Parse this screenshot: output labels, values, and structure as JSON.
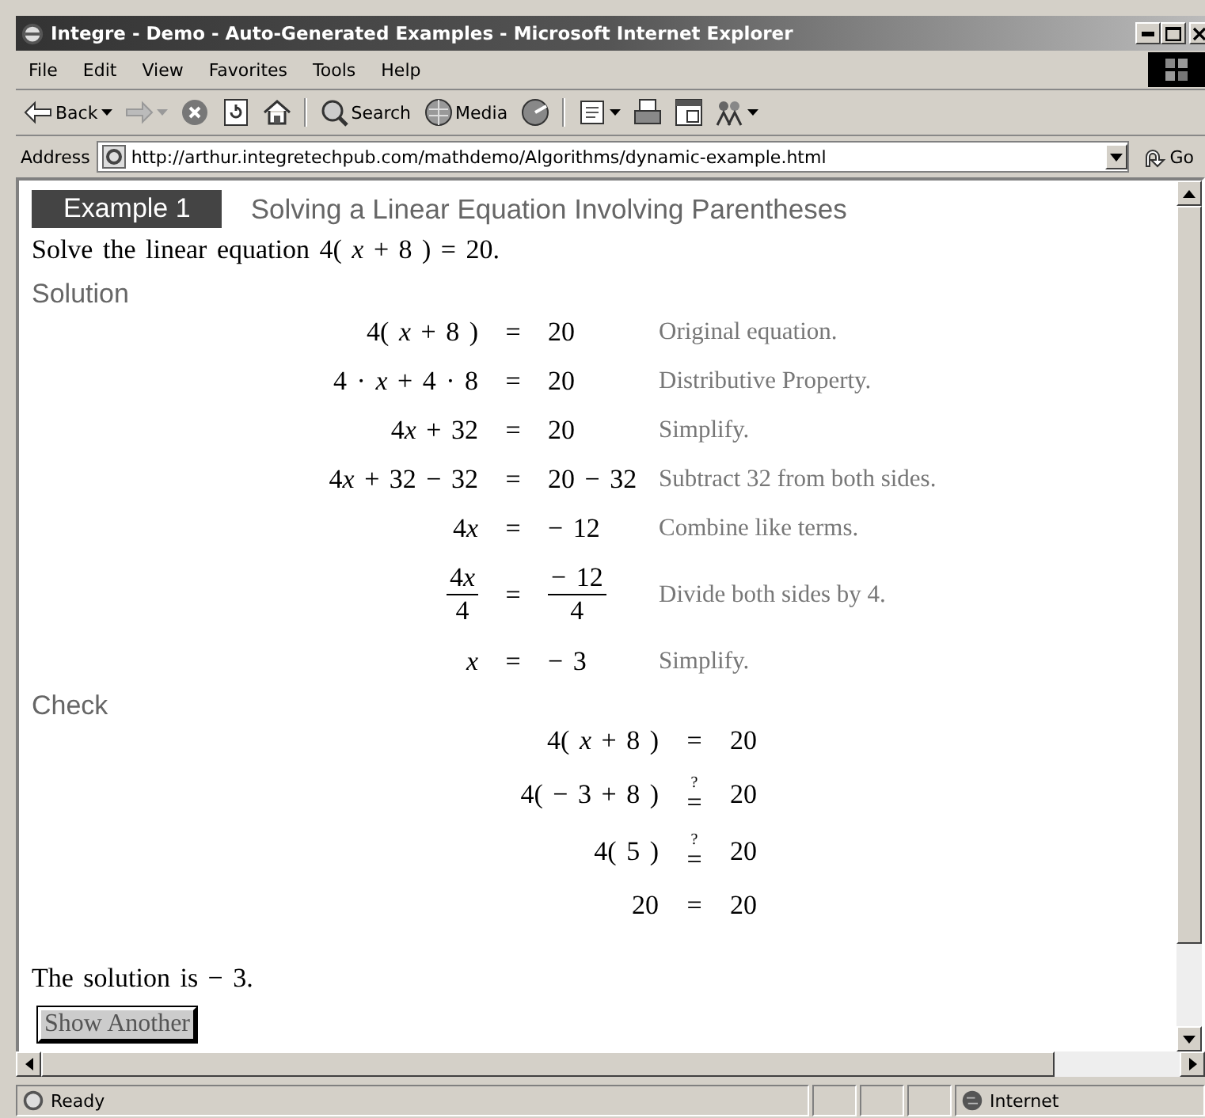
{
  "window": {
    "title": "Integre - Demo - Auto-Generated Examples - Microsoft Internet Explorer"
  },
  "menu": [
    "File",
    "Edit",
    "View",
    "Favorites",
    "Tools",
    "Help"
  ],
  "toolbar": [
    {
      "kind": "back",
      "label": "Back"
    },
    {
      "kind": "forward"
    },
    {
      "kind": "stop"
    },
    {
      "kind": "refresh"
    },
    {
      "kind": "home"
    },
    {
      "kind": "separator"
    },
    {
      "kind": "search",
      "label": "Search"
    },
    {
      "kind": "media",
      "label": "Media"
    },
    {
      "kind": "history"
    },
    {
      "kind": "separator"
    },
    {
      "kind": "mail"
    },
    {
      "kind": "print"
    },
    {
      "kind": "edit"
    },
    {
      "kind": "messenger"
    }
  ],
  "address": {
    "label": "Address",
    "value": "http://arthur.integretechpub.com/mathdemo/Algorithms/dynamic-example.html",
    "go": "Go"
  },
  "page": {
    "badge": "Example 1",
    "title": "Solving a Linear Equation Involving Parentheses",
    "problem": "Solve the linear equation 4( *x* + 8 ) = 20.",
    "solution_heading": "Solution",
    "solution": [
      {
        "kind": "plain",
        "lhs": "4( x + 8 )",
        "rel": "=",
        "rhs": "20",
        "note": "Original equation."
      },
      {
        "kind": "plain",
        "lhs": "4 · x + 4 · 8",
        "rel": "=",
        "rhs": "20",
        "note": "Distributive Property."
      },
      {
        "kind": "plain",
        "lhs": "4x + 32",
        "rel": "=",
        "rhs": "20",
        "note": "Simplify."
      },
      {
        "kind": "plain",
        "lhs": "4x + 32 − 32",
        "rel": "=",
        "rhs": "20 − 32",
        "note": "Subtract 32 from both sides."
      },
      {
        "kind": "plain",
        "lhs": "4x",
        "rel": "=",
        "rhs": "− 12",
        "note": "Combine like terms."
      },
      {
        "kind": "fraction",
        "lhs": {
          "num": "4x",
          "den": "4"
        },
        "rel": "=",
        "rhs": {
          "num": "− 12",
          "den": "4"
        },
        "note": "Divide both sides by 4."
      },
      {
        "kind": "plain",
        "lhs": "x",
        "rel": "=",
        "rhs": "− 3",
        "note": "Simplify."
      }
    ],
    "check_heading": "Check",
    "check": [
      {
        "lhs": "4( x + 8 )",
        "rel": "=",
        "rhs": "20"
      },
      {
        "lhs": "4( − 3 + 8 )",
        "query": "?",
        "rel": "=",
        "rhs": "20"
      },
      {
        "lhs": "4( 5 )",
        "query": "?",
        "rel": "=",
        "rhs": "20"
      },
      {
        "lhs": "20",
        "rel": "=",
        "rhs": "20"
      }
    ],
    "conclusion": "The solution is − 3.",
    "button": "Show Another"
  },
  "status": {
    "text": "Ready",
    "zone": "Internet"
  }
}
